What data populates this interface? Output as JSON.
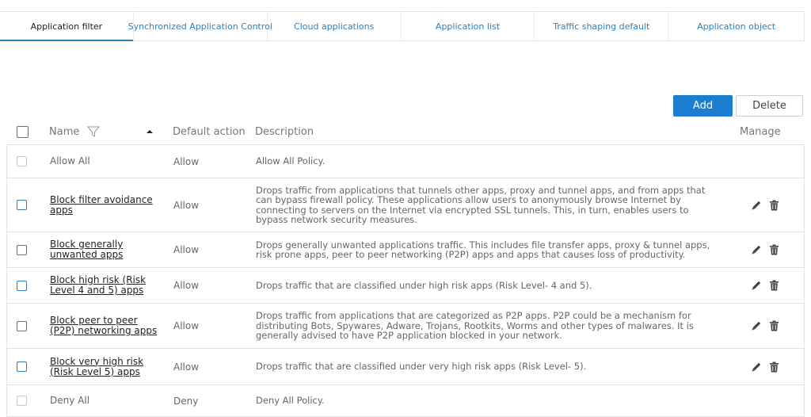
{
  "tabs": [
    {
      "label": "Application filter",
      "active": true
    },
    {
      "label": "Synchronized Application Control",
      "active": false
    },
    {
      "label": "Cloud applications",
      "active": false
    },
    {
      "label": "Application list",
      "active": false
    },
    {
      "label": "Traffic shaping default",
      "active": false
    },
    {
      "label": "Application object",
      "active": false
    }
  ],
  "toolbar": {
    "add_label": "Add",
    "delete_label": "Delete"
  },
  "table": {
    "headers": {
      "name": "Name",
      "default_action": "Default action",
      "description": "Description",
      "manage": "Manage"
    },
    "rows": [
      {
        "name": "Allow All",
        "action": "Allow",
        "description": "Allow All Policy.",
        "linked": false
      },
      {
        "name": "Block filter avoidance apps",
        "action": "Allow",
        "description": "Drops traffic from applications that tunnels other apps, proxy and tunnel apps, and from apps that can bypass firewall policy. These applications allow users to anonymously browse Internet by connecting to servers on the Internet via encrypted SSL tunnels. This, in turn, enables users to bypass network security measures.",
        "linked": true
      },
      {
        "name": "Block generally unwanted apps",
        "action": "Allow",
        "description": "Drops generally unwanted applications traffic. This includes file transfer apps, proxy & tunnel apps, risk prone apps, peer to peer networking (P2P) apps and apps that causes loss of productivity.",
        "linked": true
      },
      {
        "name": "Block high risk (Risk Level 4 and 5) apps",
        "action": "Allow",
        "description": "Drops traffic that are classified under high risk apps (Risk Level- 4 and 5).",
        "linked": true
      },
      {
        "name": "Block peer to peer (P2P) networking apps",
        "action": "Allow",
        "description": "Drops traffic from applications that are categorized as P2P apps. P2P could be a mechanism for distributing Bots, Spywares, Adware, Trojans, Rootkits, Worms and other types of malwares. It is generally advised to have P2P application blocked in your network.",
        "linked": true
      },
      {
        "name": "Block very high risk (Risk Level 5) apps",
        "action": "Allow",
        "description": "Drops traffic that are classified under very high risk apps (Risk Level- 5).",
        "linked": true
      },
      {
        "name": "Deny All",
        "action": "Deny",
        "description": "Deny All Policy.",
        "linked": false
      }
    ]
  },
  "colors": {
    "accent": "#1b7ed1",
    "tab_link": "#2a7fc1"
  }
}
